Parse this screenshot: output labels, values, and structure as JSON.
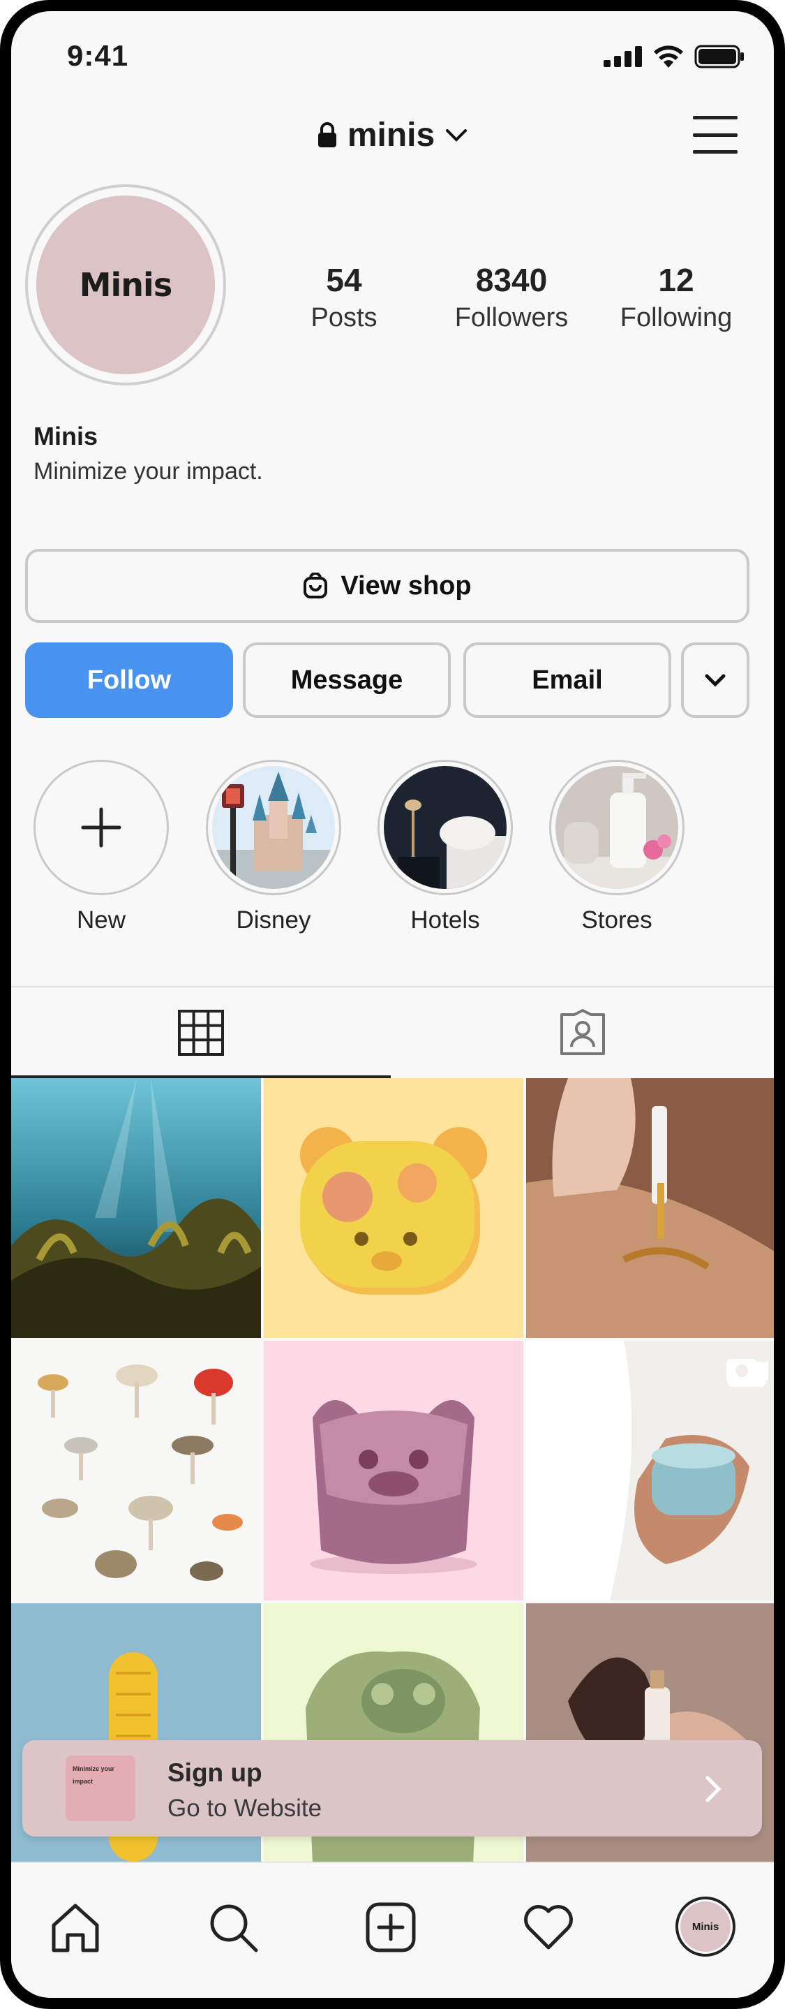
{
  "status_bar": {
    "time": "9:41"
  },
  "header": {
    "username": "minis"
  },
  "profile": {
    "avatar_text": "Minis",
    "stats": [
      {
        "value": "54",
        "label": "Posts"
      },
      {
        "value": "8340",
        "label": "Followers"
      },
      {
        "value": "12",
        "label": "Following"
      }
    ],
    "name": "Minis",
    "bio": "Minimize your impact."
  },
  "actions": {
    "view_shop": "View shop",
    "follow": "Follow",
    "message": "Message",
    "email": "Email"
  },
  "highlights": [
    {
      "label": "New"
    },
    {
      "label": "Disney"
    },
    {
      "label": "Hotels"
    },
    {
      "label": "Stores"
    }
  ],
  "banner": {
    "thumb_text": "Minimize your impact",
    "title": "Sign up",
    "subtitle": "Go to Website"
  },
  "colors": {
    "accent": "#4893f0",
    "brand_pink": "#dcc4c6",
    "background": "#f8f8f8"
  },
  "icons": {
    "lock": "lock-icon",
    "chevron": "chevron-down-icon",
    "menu": "hamburger-menu-icon",
    "shop": "shopping-bag-icon",
    "grid": "grid-icon",
    "tagged": "tagged-person-icon",
    "reel": "video-camera-icon",
    "nav": [
      "home-icon",
      "search-icon",
      "add-post-icon",
      "heart-icon",
      "profile-avatar-icon"
    ]
  }
}
